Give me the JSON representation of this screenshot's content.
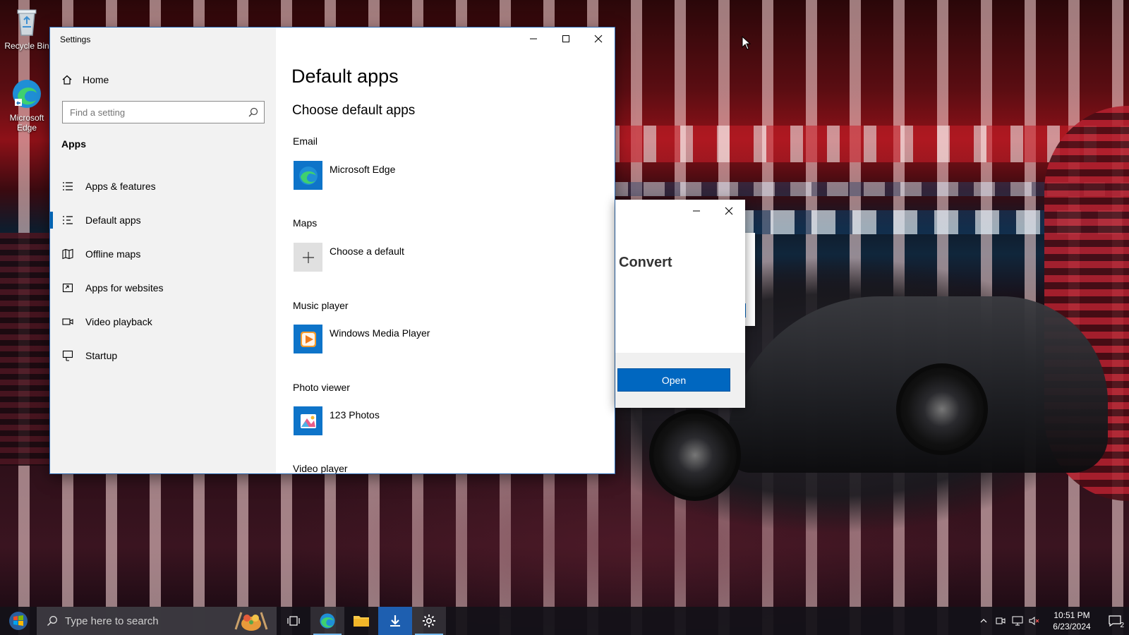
{
  "desktop": {
    "icons": [
      {
        "label": "Recycle Bin",
        "icon": "recycle-bin-icon"
      },
      {
        "label": "Microsoft Edge",
        "icon": "edge-icon"
      }
    ]
  },
  "settings": {
    "title": "Settings",
    "home_label": "Home",
    "search_placeholder": "Find a setting",
    "section_label": "Apps",
    "nav": [
      {
        "label": "Apps & features",
        "icon": "apps-list-icon"
      },
      {
        "label": "Default apps",
        "icon": "default-apps-icon",
        "active": true
      },
      {
        "label": "Offline maps",
        "icon": "map-icon"
      },
      {
        "label": "Apps for websites",
        "icon": "website-link-icon"
      },
      {
        "label": "Video playback",
        "icon": "video-camera-icon"
      },
      {
        "label": "Startup",
        "icon": "startup-icon"
      }
    ],
    "heading": "Default apps",
    "subheading": "Choose default apps",
    "categories": [
      {
        "label": "Email",
        "app": "Microsoft Edge",
        "icon": "edge-icon"
      },
      {
        "label": "Maps",
        "app": "Choose a default",
        "icon": "plus-icon"
      },
      {
        "label": "Music player",
        "app": "Windows Media Player",
        "icon": "media-player-icon"
      },
      {
        "label": "Photo viewer",
        "app": "123 Photos",
        "icon": "photos-icon"
      },
      {
        "label": "Video player",
        "app": "",
        "icon": ""
      }
    ]
  },
  "convert_dialog": {
    "title": "Convert",
    "open_label": "Open"
  },
  "taskbar": {
    "search_placeholder": "Type here to search",
    "time": "10:51 PM",
    "date": "6/23/2024",
    "notification_count": "2"
  },
  "colors": {
    "accent": "#0063b1",
    "open_button": "#0067c0",
    "taskbar": "#141218"
  }
}
